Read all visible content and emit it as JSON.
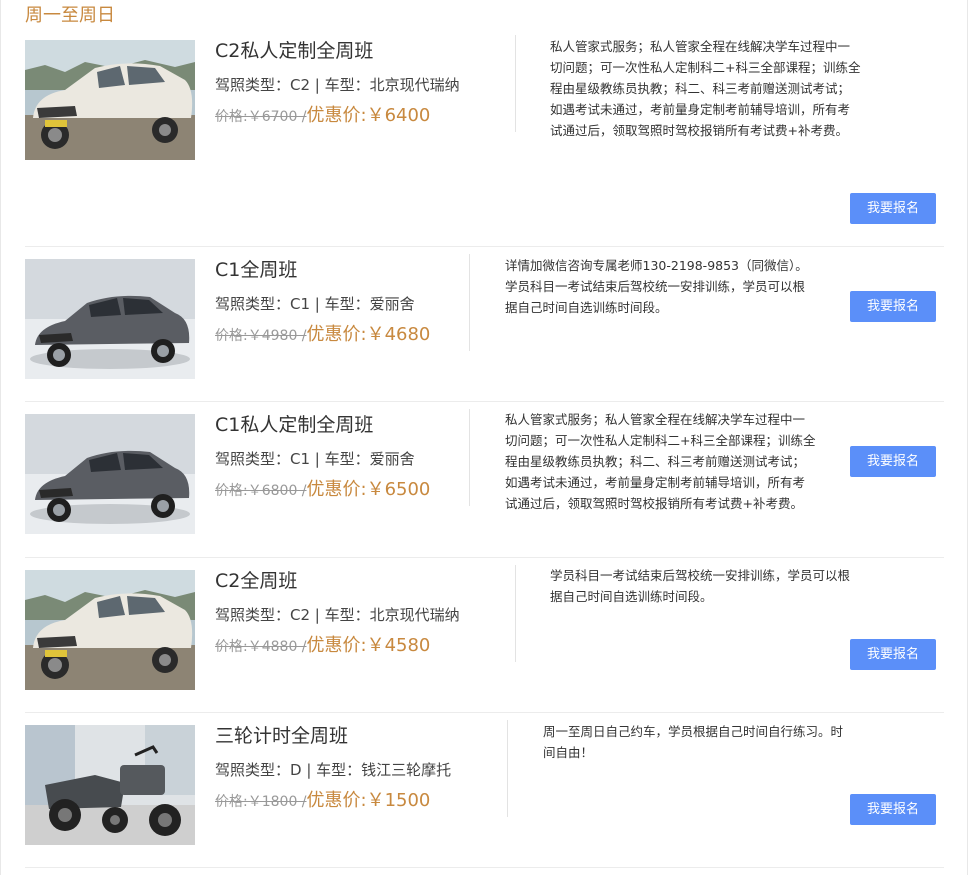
{
  "section": {
    "title": "周一至周日"
  },
  "courses": [
    {
      "title": "C2私人定制全周班",
      "license_label": "驾照类型：C2 | 车型：北京现代瑞纳",
      "old_price": "价格:￥6700 /",
      "new_price": "优惠价:￥6400",
      "description": "私人管家式服务；私人管家全程在线解决学车过程中一切问题；可一次性私人定制科二+科三全部课程；训练全程由星级教练员执教；科二、科三考前赠送测试考试；如遇考试未通过，考前量身定制考前辅导培训，所有考试通过后，领取驾照时驾校报销所有考试费+补考费。",
      "button_label": "我要报名",
      "image": "white-sedan-photo"
    },
    {
      "title": "C1全周班",
      "license_label": "驾照类型：C1 | 车型：爱丽舍",
      "old_price": "价格:￥4980 /",
      "new_price": "优惠价:￥4680",
      "description": "详情加微信咨询专属老师130-2198-9853（同微信）。学员科目一考试结束后驾校统一安排训练，学员可以根据自己时间自选训练时间段。",
      "button_label": "我要报名",
      "image": "gray-sedan-photo"
    },
    {
      "title": "C1私人定制全周班",
      "license_label": "驾照类型：C1 | 车型：爱丽舍",
      "old_price": "价格:￥6800 /",
      "new_price": "优惠价:￥6500",
      "description": "私人管家式服务；私人管家全程在线解决学车过程中一切问题；可一次性私人定制科二+科三全部课程；训练全程由星级教练员执教；科二、科三考前赠送测试考试；如遇考试未通过，考前量身定制考前辅导培训，所有考试通过后，领取驾照时驾校报销所有考试费+补考费。",
      "button_label": "我要报名",
      "image": "gray-sedan-photo"
    },
    {
      "title": "C2全周班",
      "license_label": "驾照类型：C2 | 车型：北京现代瑞纳",
      "old_price": "价格:￥4880 /",
      "new_price": "优惠价:￥4580",
      "description": "学员科目一考试结束后驾校统一安排训练，学员可以根据自己时间自选训练时间段。",
      "button_label": "我要报名",
      "image": "white-sedan-photo"
    },
    {
      "title": "三轮计时全周班",
      "license_label": "驾照类型：D | 车型：钱江三轮摩托",
      "old_price": "价格:￥1800 /",
      "new_price": "优惠价:￥1500",
      "description": "周一至周日自己约车，学员根据自己时间自行练习。时间自由！",
      "button_label": "我要报名",
      "image": "sidecar-motorcycle-photo"
    }
  ],
  "colors": {
    "accent": "#c8893f",
    "button": "#5b8ff9",
    "divider": "#ececec"
  }
}
